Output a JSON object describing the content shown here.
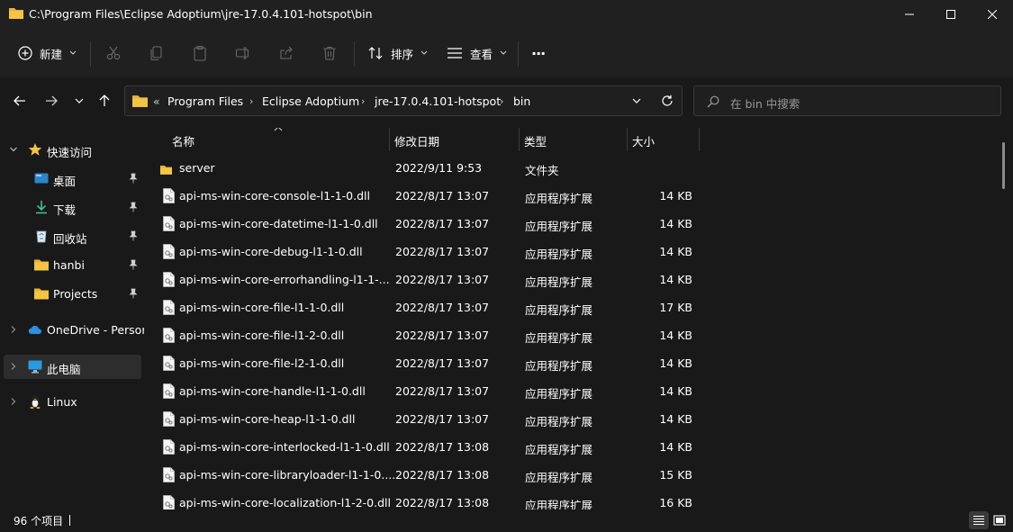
{
  "window": {
    "title": "C:\\Program Files\\Eclipse Adoptium\\jre-17.0.4.101-hotspot\\bin"
  },
  "toolbar": {
    "new_label": "新建",
    "sort_label": "排序",
    "view_label": "查看",
    "more_label": "···"
  },
  "address": {
    "prefix": "«",
    "crumbs": [
      "Program Files",
      "Eclipse Adoptium",
      "jre-17.0.4.101-hotspot",
      "bin"
    ]
  },
  "search": {
    "placeholder": "在 bin 中搜索"
  },
  "sidebar": {
    "quick_access": "快速访问",
    "items": [
      {
        "label": "桌面",
        "icon": "desktop-icon",
        "pinned": true
      },
      {
        "label": "下载",
        "icon": "download-icon",
        "pinned": true
      },
      {
        "label": "回收站",
        "icon": "recycle-bin-icon",
        "pinned": true
      },
      {
        "label": "hanbi",
        "icon": "folder-icon",
        "pinned": true
      },
      {
        "label": "Projects",
        "icon": "folder-icon",
        "pinned": true
      }
    ],
    "onedrive": "OneDrive - Persor",
    "this_pc": "此电脑",
    "linux": "Linux"
  },
  "columns": {
    "name": "名称",
    "date": "修改日期",
    "type": "类型",
    "size": "大小"
  },
  "files": [
    {
      "name": "server",
      "date": "2022/9/11 9:53",
      "type": "文件夹",
      "size": "",
      "kind": "folder"
    },
    {
      "name": "api-ms-win-core-console-l1-1-0.dll",
      "date": "2022/8/17 13:07",
      "type": "应用程序扩展",
      "size": "14 KB",
      "kind": "dll"
    },
    {
      "name": "api-ms-win-core-datetime-l1-1-0.dll",
      "date": "2022/8/17 13:07",
      "type": "应用程序扩展",
      "size": "14 KB",
      "kind": "dll"
    },
    {
      "name": "api-ms-win-core-debug-l1-1-0.dll",
      "date": "2022/8/17 13:07",
      "type": "应用程序扩展",
      "size": "14 KB",
      "kind": "dll"
    },
    {
      "name": "api-ms-win-core-errorhandling-l1-1-...",
      "date": "2022/8/17 13:07",
      "type": "应用程序扩展",
      "size": "14 KB",
      "kind": "dll"
    },
    {
      "name": "api-ms-win-core-file-l1-1-0.dll",
      "date": "2022/8/17 13:07",
      "type": "应用程序扩展",
      "size": "17 KB",
      "kind": "dll"
    },
    {
      "name": "api-ms-win-core-file-l1-2-0.dll",
      "date": "2022/8/17 13:07",
      "type": "应用程序扩展",
      "size": "14 KB",
      "kind": "dll"
    },
    {
      "name": "api-ms-win-core-file-l2-1-0.dll",
      "date": "2022/8/17 13:07",
      "type": "应用程序扩展",
      "size": "14 KB",
      "kind": "dll"
    },
    {
      "name": "api-ms-win-core-handle-l1-1-0.dll",
      "date": "2022/8/17 13:07",
      "type": "应用程序扩展",
      "size": "14 KB",
      "kind": "dll"
    },
    {
      "name": "api-ms-win-core-heap-l1-1-0.dll",
      "date": "2022/8/17 13:07",
      "type": "应用程序扩展",
      "size": "14 KB",
      "kind": "dll"
    },
    {
      "name": "api-ms-win-core-interlocked-l1-1-0.dll",
      "date": "2022/8/17 13:08",
      "type": "应用程序扩展",
      "size": "14 KB",
      "kind": "dll"
    },
    {
      "name": "api-ms-win-core-libraryloader-l1-1-0....",
      "date": "2022/8/17 13:08",
      "type": "应用程序扩展",
      "size": "15 KB",
      "kind": "dll"
    },
    {
      "name": "api-ms-win-core-localization-l1-2-0.dll",
      "date": "2022/8/17 13:08",
      "type": "应用程序扩展",
      "size": "16 KB",
      "kind": "dll"
    }
  ],
  "status": {
    "item_count": "96 个项目"
  },
  "colors": {
    "folder": "#f4c542",
    "background": "#191919",
    "chrome": "#202020"
  }
}
